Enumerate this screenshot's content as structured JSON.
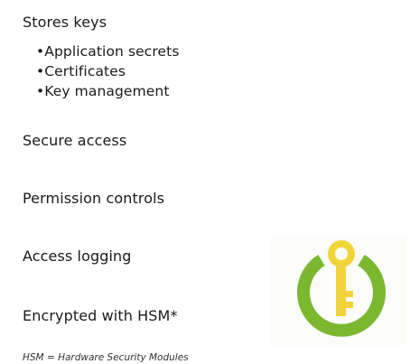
{
  "slide": {
    "items": [
      {
        "label": "Stores keys"
      },
      {
        "label": "Secure access"
      },
      {
        "label": "Permission controls"
      },
      {
        "label": "Access logging"
      },
      {
        "label": "Encrypted with HSM*"
      }
    ],
    "sub_items": [
      {
        "label": "•Application secrets"
      },
      {
        "label": "•Certificates"
      },
      {
        "label": "•Key management"
      }
    ],
    "footnote": "HSM = Hardware Security Modules"
  },
  "icon": {
    "name": "key-vault-icon",
    "ring_color": "#7cb82f",
    "key_color": "#f2d43a"
  }
}
